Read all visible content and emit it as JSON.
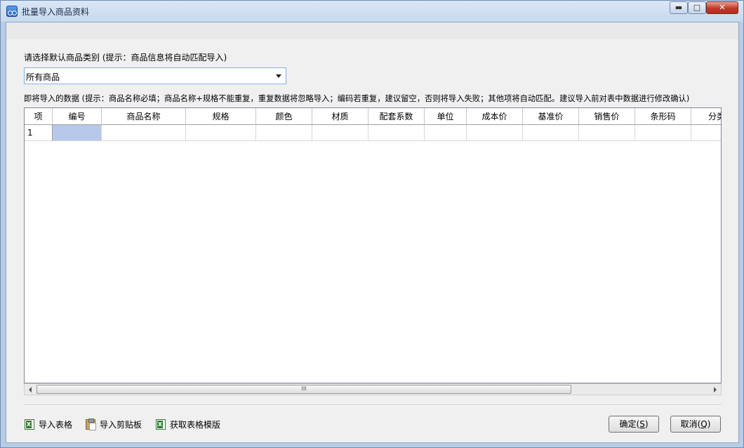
{
  "window": {
    "title": "批量导入商品资料",
    "min_glyph": "▬",
    "max_glyph": "□",
    "close_glyph": "✕"
  },
  "category": {
    "prompt": "请选择默认商品类别 (提示：商品信息将自动匹配导入)",
    "selected": "所有商品"
  },
  "import_hint": "即将导入的数据 (提示：商品名称必填；商品名称+规格不能重复，重复数据将忽略导入；编码若重复，建议留空，否则将导入失败；其他项将自动匹配。建议导入前对表中数据进行修改确认)",
  "table": {
    "columns": [
      "项",
      "编号",
      "商品名称",
      "规格",
      "颜色",
      "材质",
      "配套系数",
      "单位",
      "成本价",
      "基准价",
      "销售价",
      "条形码",
      "分类"
    ],
    "rows": [
      {
        "index": "1"
      }
    ]
  },
  "scrollbar": {
    "grip": "III"
  },
  "actions": {
    "import_table": "导入表格",
    "import_clipboard": "导入剪贴板",
    "get_template": "获取表格模版"
  },
  "buttons": {
    "ok_prefix": "确定(",
    "ok_key": "S",
    "ok_suffix": ")",
    "cancel_prefix": "取消(",
    "cancel_key": "Q",
    "cancel_suffix": ")"
  }
}
